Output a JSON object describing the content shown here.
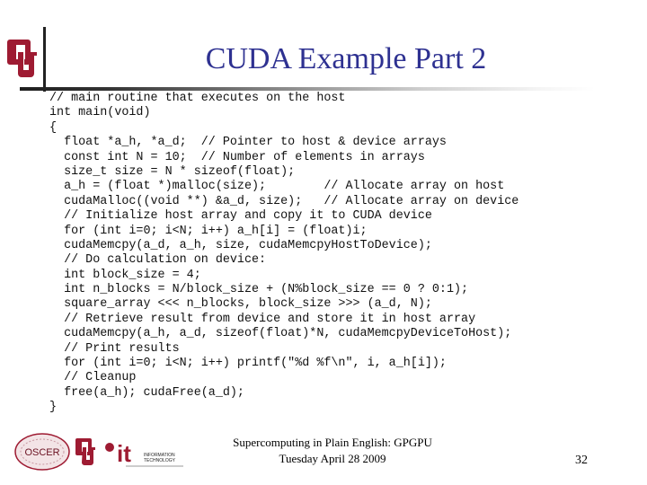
{
  "slide": {
    "title": "CUDA Example Part 2",
    "code_lines": [
      "// main routine that executes on the host",
      "int main(void)",
      "{",
      "  float *a_h, *a_d;  // Pointer to host & device arrays",
      "  const int N = 10;  // Number of elements in arrays",
      "  size_t size = N * sizeof(float);",
      "  a_h = (float *)malloc(size);        // Allocate array on host",
      "  cudaMalloc((void **) &a_d, size);   // Allocate array on device",
      "  // Initialize host array and copy it to CUDA device",
      "  for (int i=0; i<N; i++) a_h[i] = (float)i;",
      "  cudaMemcpy(a_d, a_h, size, cudaMemcpyHostToDevice);",
      "  // Do calculation on device:",
      "  int block_size = 4;",
      "  int n_blocks = N/block_size + (N%block_size == 0 ? 0:1);",
      "  square_array <<< n_blocks, block_size >>> (a_d, N);",
      "  // Retrieve result from device and store it in host array",
      "  cudaMemcpy(a_h, a_d, sizeof(float)*N, cudaMemcpyDeviceToHost);",
      "  // Print results",
      "  for (int i=0; i<N; i++) printf(\"%d %f\\n\", i, a_h[i]);",
      "  // Cleanup",
      "  free(a_h); cudaFree(a_d);",
      "}"
    ]
  },
  "footer": {
    "line1": "Supercomputing in Plain English: GPGPU",
    "line2": "Tuesday April 28 2009",
    "page_number": "32",
    "logos": {
      "oscer_label": "OSCER",
      "it_label": "it",
      "it_text_1": "INFORMATION",
      "it_text_2": "TECHNOLOGY"
    }
  },
  "colors": {
    "title": "#2e3191",
    "ou_crimson": "#9e1b32"
  }
}
